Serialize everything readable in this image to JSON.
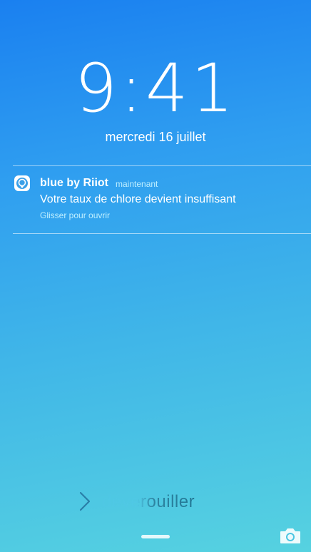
{
  "lock_screen": {
    "time": "9:41",
    "date": "mercredi 16 juillet"
  },
  "notification": {
    "app_name": "blue by Riiot",
    "time": "maintenant",
    "message": "Votre taux de chlore devient insuffisant",
    "hint": "Glisser pour ouvrir",
    "icon": "blue-riiot-app-icon"
  },
  "unlock": {
    "label": "déverouiller",
    "icon": "chevron-right-icon"
  },
  "bottom": {
    "camera_icon": "camera-icon",
    "home_indicator": "home-indicator"
  },
  "colors": {
    "gradient_top": "#1a80f0",
    "gradient_bottom": "#56d2e0",
    "secondary_text": "#bfefff"
  }
}
